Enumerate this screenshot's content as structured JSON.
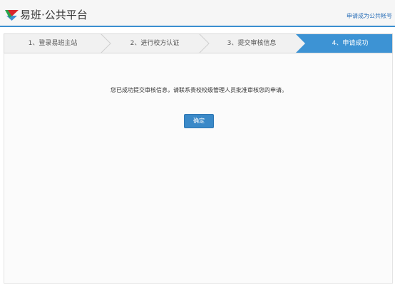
{
  "header": {
    "brand_title": "易班·公共平台",
    "apply_link": "申请成为公共帐号",
    "logo_icon": "yiban-logo-icon"
  },
  "steps": [
    {
      "label": "1、登录易班主站",
      "active": false
    },
    {
      "label": "2、进行校方认证",
      "active": false
    },
    {
      "label": "3、提交审核信息",
      "active": false
    },
    {
      "label": "4、申请成功",
      "active": true
    }
  ],
  "main": {
    "message": "您已成功提交审核信息，请联系贵校校级管理人员批准审核您的申请。",
    "confirm_label": "确定"
  },
  "colors": {
    "accent": "#3d93d4",
    "header_rule": "#3b8fd0",
    "link": "#2a6fb8"
  }
}
